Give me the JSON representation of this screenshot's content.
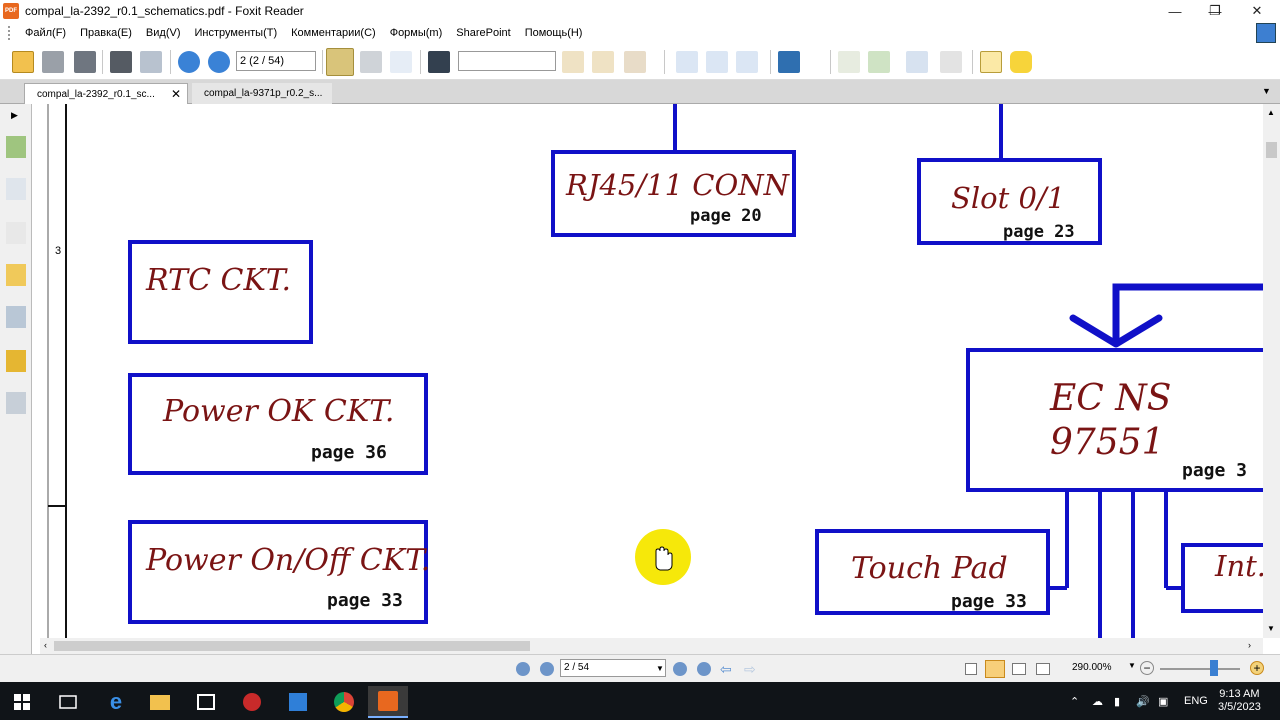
{
  "window": {
    "title": "compal_la-2392_r0.1_schematics.pdf - Foxit Reader",
    "app_icon_label": "PDF"
  },
  "menu": {
    "items": [
      "Файл(F)",
      "Правка(E)",
      "Вид(V)",
      "Инструменты(T)",
      "Комментарии(C)",
      "Формы(m)",
      "SharePoint",
      "Помощь(H)"
    ]
  },
  "toolbar": {
    "page_field": "2 (2 / 54)",
    "search_value": ""
  },
  "tabs": [
    {
      "label": "compal_la-2392_r0.1_sc...",
      "active": true,
      "close": "✕"
    },
    {
      "label": "compal_la-9371p_r0.2_s...",
      "active": false
    }
  ],
  "document": {
    "row_label": "3",
    "blocks": {
      "rj45": {
        "title": "RJ45/11 CONN",
        "page": "page 20"
      },
      "slot": {
        "title": "Slot 0/1",
        "page": "page 23"
      },
      "rtc": {
        "title": "RTC CKT."
      },
      "power_ok": {
        "title": "Power OK CKT.",
        "page": "page 36"
      },
      "power_onoff": {
        "title": "Power On/Off CKT.",
        "page": "page 33"
      },
      "ec": {
        "title_line1": "EC NS",
        "title_line2": "97551",
        "page": "page 3"
      },
      "touchpad": {
        "title": "Touch Pad",
        "page": "page 33"
      },
      "int": {
        "title": "Int."
      }
    },
    "line_color": "#1010c8",
    "text_color": "#7a1414"
  },
  "statusbar": {
    "page_field": "2 / 54",
    "zoom": "290.00%"
  },
  "taskbar": {
    "language": "ENG",
    "time": "9:13 AM",
    "date": "3/5/2023"
  }
}
